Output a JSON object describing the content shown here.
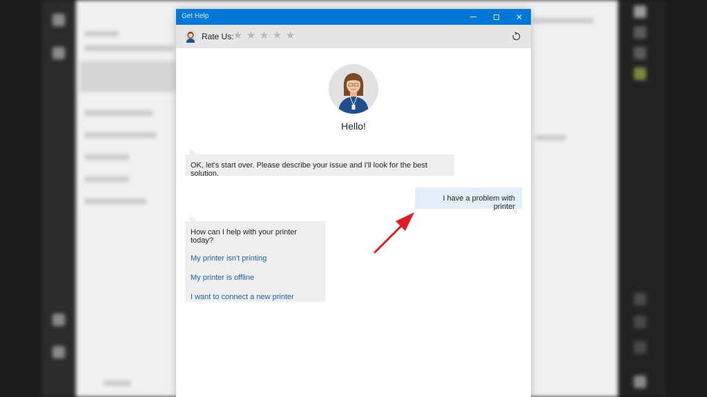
{
  "window": {
    "title": "Get Help"
  },
  "rate_bar": {
    "label": "Rate Us:",
    "stars": 5,
    "rating": 0
  },
  "greeting": "Hello!",
  "conversation": {
    "agent_message_1": "OK, let's start over. Please describe your issue and I'll look for the best solution.",
    "user_message": "I have a problem with printer",
    "agent_message_2": "How can I help with your printer today?",
    "options": [
      "My printer isn't printing",
      "My printer is offline",
      "I want to connect a new printer"
    ]
  },
  "colors": {
    "accent": "#0078d7",
    "link": "#1a5fb4",
    "annotation_arrow": "#e01b24"
  }
}
